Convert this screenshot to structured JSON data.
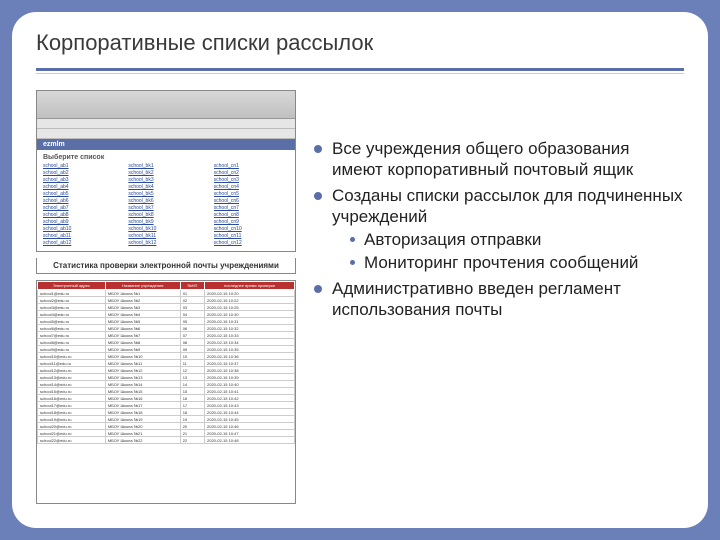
{
  "title": "Корпоративные списки рассылок",
  "browser_brand": "ezmlm",
  "pick_list_title": "Выберите список",
  "stats_caption": "Статистика проверки электронной почты учреждениями",
  "links": {
    "col1": [
      "school_ab1",
      "school_ab2",
      "school_ab3",
      "school_ab4",
      "school_ab5",
      "school_ab6",
      "school_ab7",
      "school_ab8",
      "school_ab9",
      "school_ab10",
      "school_ab11",
      "school_ab12"
    ],
    "col2": [
      "school_bk1",
      "school_bk2",
      "school_bk3",
      "school_bk4",
      "school_bk5",
      "school_bk6",
      "school_bk7",
      "school_bk8",
      "school_bk9",
      "school_bk10",
      "school_bk11",
      "school_bk12"
    ],
    "col3": [
      "school_cn1",
      "school_cn2",
      "school_cn3",
      "school_cn4",
      "school_cn5",
      "school_cn6",
      "school_cn7",
      "school_cn8",
      "school_cn9",
      "school_cn10",
      "school_cn11",
      "school_cn12"
    ]
  },
  "table": {
    "headers": [
      "Электронный адрес",
      "Название учреждения",
      "№НП",
      "последнее время проверки"
    ],
    "rows": [
      [
        "school1@edu.ru",
        "МБОУ Школа №1",
        "01",
        "2020-02-15 10:20"
      ],
      [
        "school2@edu.ru",
        "МБОУ Школа №2",
        "02",
        "2020-02-15 10:22"
      ],
      [
        "school3@edu.ru",
        "МБОУ Школа №3",
        "03",
        "2020-02-15 10:25"
      ],
      [
        "school4@edu.ru",
        "МБОУ Школа №4",
        "04",
        "2020-02-15 10:30"
      ],
      [
        "school5@edu.ru",
        "МБОУ Школа №5",
        "05",
        "2020-02-15 10:31"
      ],
      [
        "school6@edu.ru",
        "МБОУ Школа №6",
        "06",
        "2020-02-15 10:32"
      ],
      [
        "school7@edu.ru",
        "МБОУ Школа №7",
        "07",
        "2020-02-15 10:33"
      ],
      [
        "school8@edu.ru",
        "МБОУ Школа №8",
        "08",
        "2020-02-15 10:34"
      ],
      [
        "school9@edu.ru",
        "МБОУ Школа №9",
        "09",
        "2020-02-15 10:35"
      ],
      [
        "school10@edu.ru",
        "МБОУ Школа №10",
        "10",
        "2020-02-15 10:36"
      ],
      [
        "school11@edu.ru",
        "МБОУ Школа №11",
        "11",
        "2020-02-15 10:37"
      ],
      [
        "school12@edu.ru",
        "МБОУ Школа №12",
        "12",
        "2020-02-15 10:38"
      ],
      [
        "school13@edu.ru",
        "МБОУ Школа №13",
        "13",
        "2020-02-15 10:39"
      ],
      [
        "school14@edu.ru",
        "МБОУ Школа №14",
        "14",
        "2020-02-15 10:40"
      ],
      [
        "school15@edu.ru",
        "МБОУ Школа №15",
        "15",
        "2020-02-15 10:41"
      ],
      [
        "school16@edu.ru",
        "МБОУ Школа №16",
        "16",
        "2020-02-15 10:42"
      ],
      [
        "school17@edu.ru",
        "МБОУ Школа №17",
        "17",
        "2020-02-15 10:43"
      ],
      [
        "school18@edu.ru",
        "МБОУ Школа №18",
        "18",
        "2020-02-15 10:44"
      ],
      [
        "school19@edu.ru",
        "МБОУ Школа №19",
        "19",
        "2020-02-15 10:45"
      ],
      [
        "school20@edu.ru",
        "МБОУ Школа №20",
        "20",
        "2020-02-15 10:46"
      ],
      [
        "school21@edu.ru",
        "МБОУ Школа №21",
        "21",
        "2020-02-15 10:47"
      ],
      [
        "school22@edu.ru",
        "МБОУ Школа №22",
        "22",
        "2020-02-15 10:48"
      ]
    ]
  },
  "bullets": [
    {
      "text": "Все учреждения общего образования имеют корпоративный почтовый ящик"
    },
    {
      "text": "Созданы списки рассылок для подчиненных учреждений",
      "sub": [
        "Авторизация отправки",
        "Мониторинг прочтения сообщений"
      ]
    },
    {
      "text": "Административно введен регламент использования почты"
    }
  ]
}
